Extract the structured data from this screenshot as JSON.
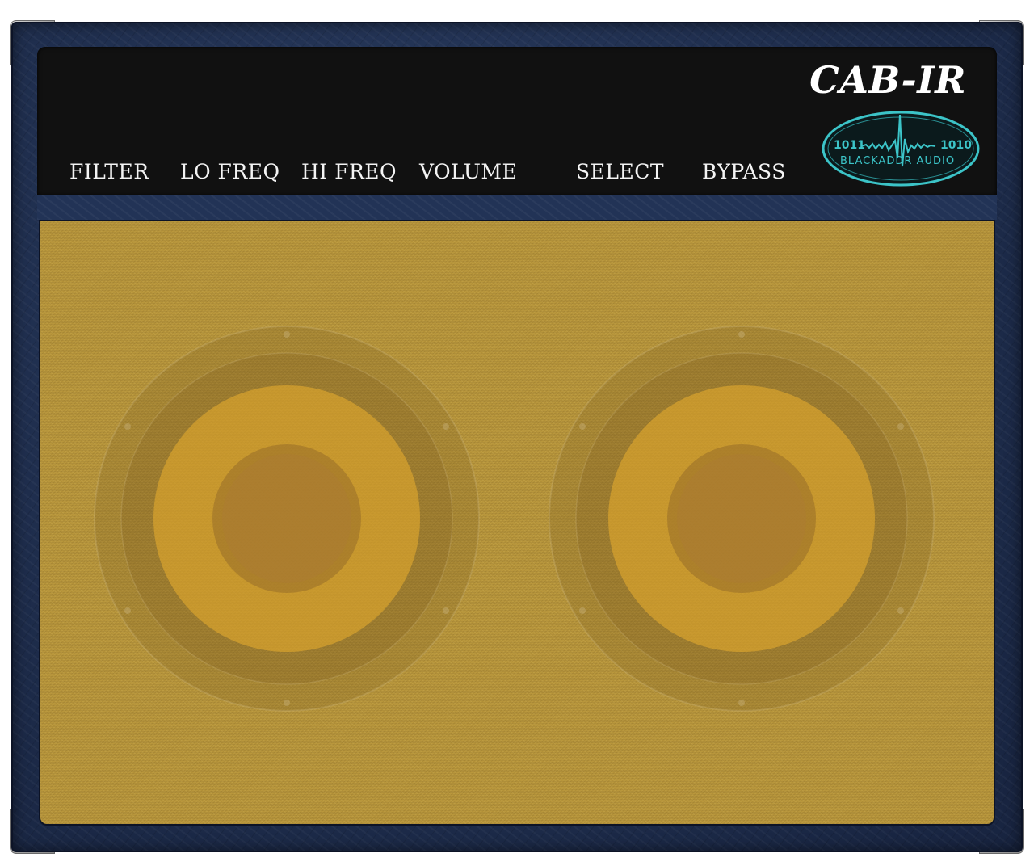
{
  "header": {
    "title": "CAB-IR",
    "controls": [
      {
        "id": "filter",
        "label": "FILTER"
      },
      {
        "id": "lo_freq",
        "label": "LO FREQ"
      },
      {
        "id": "hi_freq",
        "label": "HI FREQ"
      },
      {
        "id": "volume",
        "label": "VOLUME"
      },
      {
        "id": "select",
        "label": "SELECT"
      },
      {
        "id": "bypass",
        "label": "BYPASS"
      }
    ]
  },
  "logo": {
    "left_code": "1011",
    "right_code": "1010",
    "brand": "BLACKADDR AUDIO"
  },
  "colors": {
    "tolex": "#1c2a48",
    "panel": "#111111",
    "grille": "#b9973c",
    "logo_accent": "#3cc4c8",
    "cone": "#e0a82a"
  }
}
